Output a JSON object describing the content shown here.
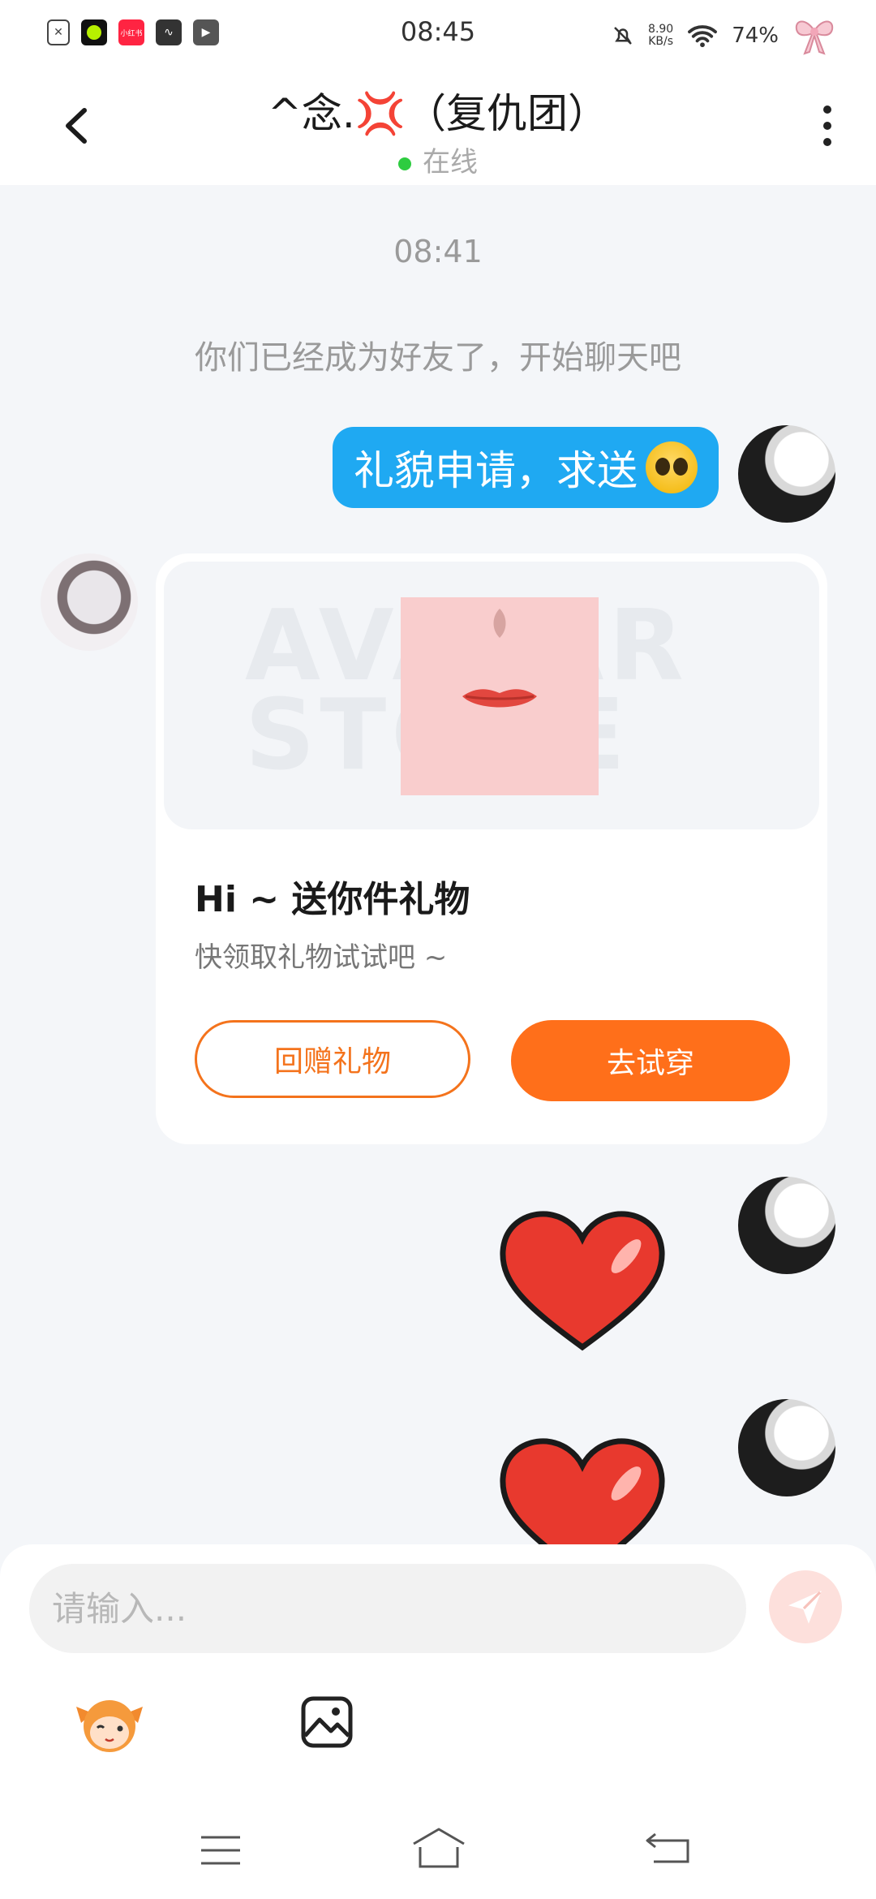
{
  "status_bar": {
    "time": "08:45",
    "net_speed_value": "8.90",
    "net_speed_unit": "KB/s",
    "battery": "74%",
    "app_icons": [
      "file-icon",
      "green-app-icon",
      "xiaohongshu-icon",
      "w-app-icon",
      "play-icon"
    ],
    "xiaohongshu_label": "小红书"
  },
  "header": {
    "title": "^念.💢（复仇团）",
    "status": "在线"
  },
  "chat": {
    "timestamp": "08:41",
    "system_message": "你们已经成为好友了，开始聊天吧",
    "outgoing_text": "礼貌申请，求送",
    "gift_card": {
      "title": "Hi ~ 送你件礼物",
      "subtitle": "快领取礼物试试吧 ~",
      "watermark": "AVATAR STORE",
      "return_gift_label": "回赠礼物",
      "try_on_label": "去试穿"
    }
  },
  "input": {
    "placeholder": "请输入..."
  },
  "colors": {
    "bubble_blue": "#1fa9f2",
    "accent_orange": "#ff6f1a",
    "online_green": "#2ecc40",
    "background": "#f4f6f9"
  }
}
